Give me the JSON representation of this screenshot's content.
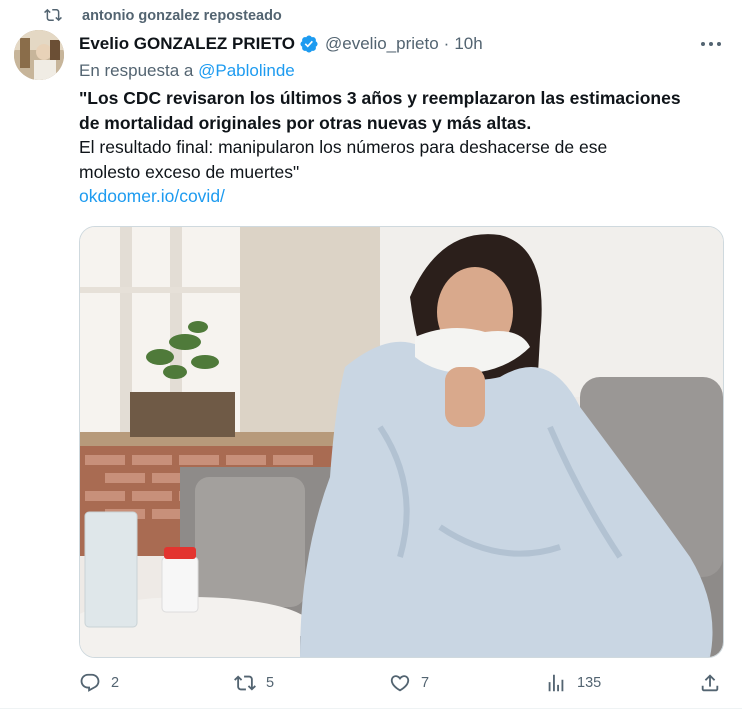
{
  "repost": {
    "icon": "repost-icon",
    "text": "antonio gonzalez reposteado"
  },
  "author": {
    "name": "Evelio GONZALEZ PRIETO",
    "verified_icon": "verified-badge-icon",
    "handle": "@evelio_prieto",
    "separator": "·",
    "time": "10h",
    "avatar_icon": "avatar"
  },
  "reply": {
    "prefix": "En respuesta a",
    "mention": "@Pablolinde"
  },
  "tweet": {
    "bold_line1": "\"Los CDC revisaron los últimos 3 años y reemplazaron las estimaciones",
    "bold_line2": "de mortalidad originales por otras nuevas y más altas.",
    "plain_line1": "El resultado final: manipularon los números para deshacerse de ese",
    "plain_line2": "molesto exceso de muertes\"",
    "link": "okdoomer.io/covid/"
  },
  "media": {
    "kind": "photo",
    "subject": "woman wrapped in blanket blowing nose on sofa"
  },
  "actions": {
    "reply_count": "2",
    "repost_count": "5",
    "like_count": "7",
    "views_count": "135"
  },
  "colors": {
    "accent": "#1d9bf0",
    "muted": "#536471",
    "text": "#0f1419"
  }
}
